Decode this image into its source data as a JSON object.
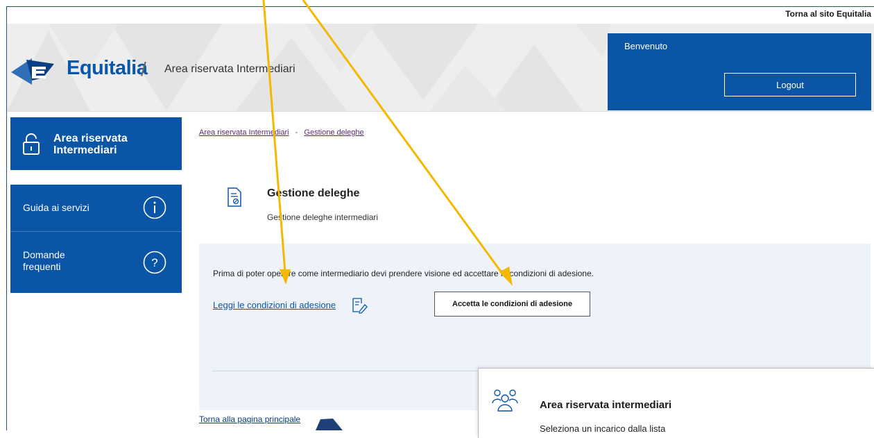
{
  "topbar": {
    "return_link": "Torna al sito Equitalia"
  },
  "header": {
    "logo_name": "Equitalia",
    "slash": "/",
    "area_title": "Area riservata Intermediari",
    "welcome": "Benvenuto",
    "logout_label": "Logout"
  },
  "sidebar": {
    "header_label_1": "Area riservata",
    "header_label_2": "Intermediari",
    "items": [
      {
        "label_1": "Guida ai servizi",
        "label_2": "",
        "icon": "info-icon"
      },
      {
        "label_1": "Domande",
        "label_2": "frequenti",
        "icon": "question-icon"
      }
    ]
  },
  "breadcrumb": {
    "items": [
      "Area riservata Intermediari",
      "Gestione deleghe"
    ],
    "separator": "-"
  },
  "page": {
    "title": "Gestione deleghe",
    "subtitle": "Gestione deleghe intermediari"
  },
  "panel": {
    "notice": "Prima di poter operare come intermediario devi prendere visione ed accettare le condizioni di adesione.",
    "read_link": "Leggi le condizioni di adesione",
    "accept_button": "Accetta le condizioni di adesione"
  },
  "footer": {
    "back_link": "Torna alla pagina principale"
  },
  "popup": {
    "title": "Area riservata intermediari",
    "subtitle": "Seleziona un incarico dalla lista"
  },
  "colors": {
    "brand": "#0a55a6",
    "annotation_arrow": "#f5b800",
    "panel_bg": "#eef3fa"
  }
}
